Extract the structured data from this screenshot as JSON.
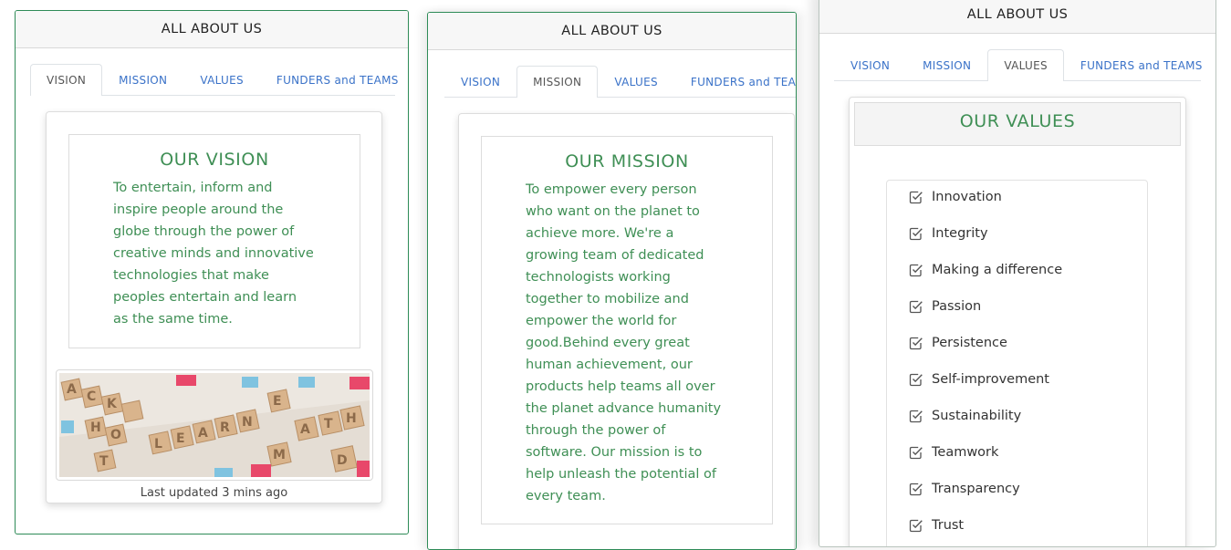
{
  "header_title": "ALL ABOUT US",
  "tabs": [
    "VISION",
    "MISSION",
    "VALUES",
    "FUNDERS and TEAMS"
  ],
  "vision": {
    "title": "OUR VISION",
    "lines": [
      "To entertain, inform and",
      "inspire people around the",
      "globe through the power of",
      "creative minds and innovative",
      "technologies that make",
      "peoples entertain and learn",
      "as the same time."
    ],
    "caption": "Last updated 3 mins ago"
  },
  "mission": {
    "title": "OUR MISSION",
    "lines": [
      "To empower every person",
      "who want on the planet to",
      "achieve more. We're a",
      "growing team of dedicated",
      "technologists working",
      "together to mobilize and",
      "empower the world for",
      "good.Behind every great",
      "human achievement, our",
      "products help teams all over",
      "the planet advance humanity",
      "through the power of",
      "software. Our mission is to",
      "help unleash the potential of",
      "every team."
    ]
  },
  "values": {
    "title": "OUR VALUES",
    "items": [
      "Innovation",
      "Integrity",
      "Making a difference",
      "Passion",
      "Persistence",
      "Self-improvement",
      "Sustainability",
      "Teamwork",
      "Transparency",
      "Trust"
    ]
  },
  "colors": {
    "accent_green": "#3f8f55",
    "tab_blue": "#3a72c8",
    "border_green": "#2e8b57"
  }
}
